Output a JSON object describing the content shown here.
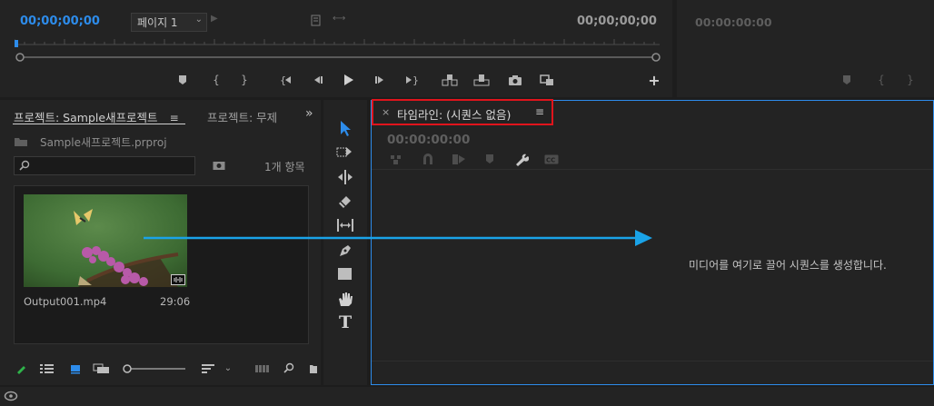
{
  "source_monitor": {
    "timecode_left": "00;00;00;00",
    "page_select": "페이지 1",
    "timecode_right": "00;00;00;00"
  },
  "program_monitor": {
    "timecode": "00:00:00:00"
  },
  "project_panel": {
    "tab_active": "프로젝트: Sample새프로젝트",
    "tab_inactive": "프로젝트: 무제",
    "menu_icon": "≡",
    "overflow_icon": "»",
    "project_file": "Sample새프로젝트.prproj",
    "search_placeholder": "",
    "item_count": "1개 항목",
    "clip": {
      "name": "Output001.mp4",
      "duration": "29:06"
    }
  },
  "timeline": {
    "tab_close": "×",
    "tab_label": "타임라인: (시퀀스 없음)",
    "tab_menu": "≡",
    "timecode": "00:00:00:00",
    "empty_message": "미디어를 여기로 끌어 시퀀스를 생성합니다."
  },
  "tools": {
    "type_tool_glyph": "T"
  },
  "colors": {
    "accent_blue": "#2d8ceb",
    "highlight_red": "#e0141c",
    "arrow_blue": "#1aa3e8",
    "panel_bg": "#232323"
  },
  "icons": [
    "marker-icon",
    "in-point-icon",
    "out-point-icon",
    "go-to-in-icon",
    "step-back-icon",
    "play-icon",
    "step-forward-icon",
    "go-to-out-icon",
    "insert-icon",
    "overwrite-icon",
    "camera-icon",
    "export-frame-icon",
    "add-icon",
    "selection-tool-icon",
    "track-select-tool-icon",
    "ripple-edit-tool-icon",
    "razor-tool-icon",
    "slip-tool-icon",
    "pen-tool-icon",
    "rectangle-tool-icon",
    "hand-tool-icon",
    "type-tool-icon"
  ]
}
